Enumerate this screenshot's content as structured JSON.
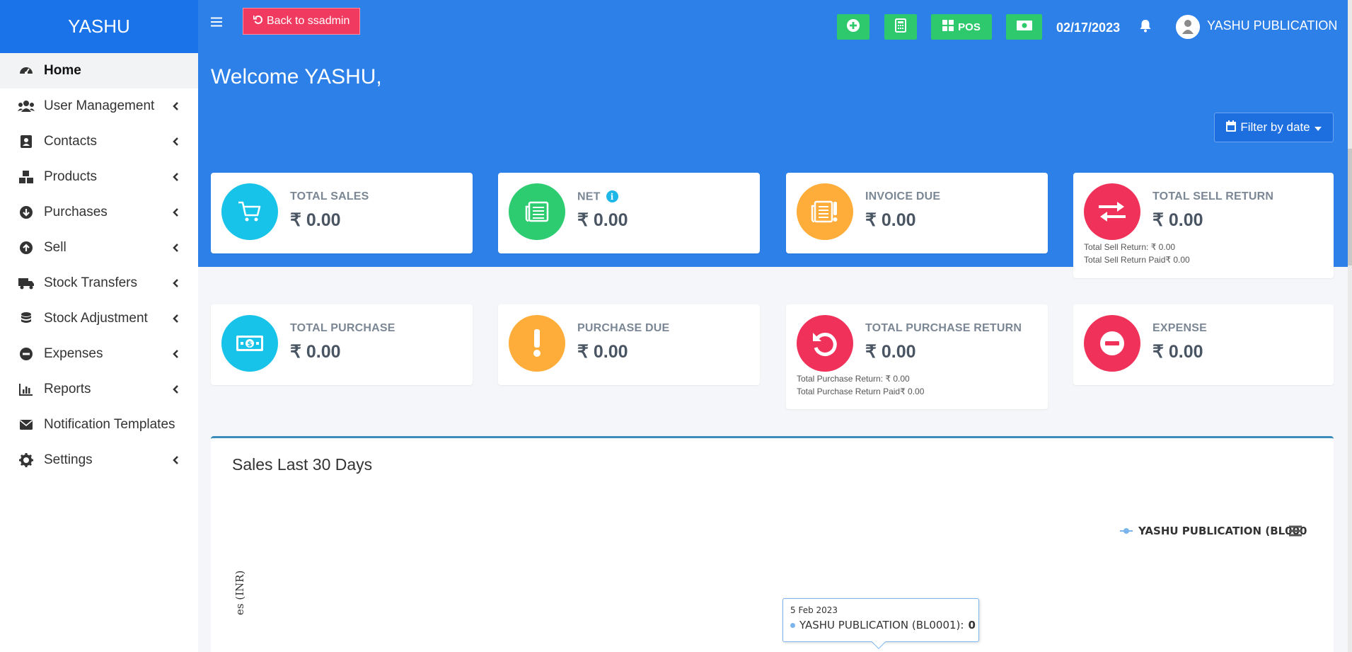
{
  "sidebar": {
    "brand": "YASHU",
    "items": [
      {
        "label": "Home",
        "icon": "tachometer-icon",
        "active": true
      },
      {
        "label": "User Management",
        "icon": "users-icon"
      },
      {
        "label": "Contacts",
        "icon": "address-book-icon"
      },
      {
        "label": "Products",
        "icon": "cubes-icon"
      },
      {
        "label": "Purchases",
        "icon": "arrow-circle-down-icon"
      },
      {
        "label": "Sell",
        "icon": "arrow-circle-up-icon"
      },
      {
        "label": "Stock Transfers",
        "icon": "truck-icon"
      },
      {
        "label": "Stock Adjustment",
        "icon": "database-icon"
      },
      {
        "label": "Expenses",
        "icon": "minus-circle-icon"
      },
      {
        "label": "Reports",
        "icon": "bar-chart-icon"
      },
      {
        "label": "Notification Templates",
        "icon": "envelope-icon"
      },
      {
        "label": "Settings",
        "icon": "gear-icon"
      }
    ]
  },
  "topbar": {
    "back_label": "Back to ssadmin",
    "pos_label": "POS",
    "date": "02/17/2023",
    "user_name": "YASHU PUBLICATION"
  },
  "header": {
    "welcome": "Welcome YASHU,",
    "filter_label": "Filter by date"
  },
  "cards": {
    "total_sales": {
      "label": "TOTAL SALES",
      "value": "₹ 0.00",
      "color": "#17c3e8"
    },
    "net": {
      "label": "NET",
      "value": "₹ 0.00",
      "color": "#2ecc71"
    },
    "invoice_due": {
      "label": "INVOICE DUE",
      "value": "₹ 0.00",
      "color": "#ffad3a"
    },
    "total_sell_return": {
      "label": "TOTAL SELL RETURN",
      "value": "₹ 0.00",
      "color": "#f0325a",
      "note1": "Total Sell Return: ₹ 0.00",
      "note2": "Total Sell Return Paid₹ 0.00"
    },
    "total_purchase": {
      "label": "TOTAL PURCHASE",
      "value": "₹ 0.00",
      "color": "#17c3e8"
    },
    "purchase_due": {
      "label": "PURCHASE DUE",
      "value": "₹ 0.00",
      "color": "#ffad3a"
    },
    "total_purchase_return": {
      "label": "TOTAL PURCHASE RETURN",
      "value": "₹ 0.00",
      "color": "#f0325a",
      "note1": "Total Purchase Return: ₹ 0.00",
      "note2": "Total Purchase Return Paid₹ 0.00"
    },
    "expense": {
      "label": "EXPENSE",
      "value": "₹ 0.00",
      "color": "#f0325a"
    }
  },
  "chart": {
    "title": "Sales Last 30 Days",
    "legend": "YASHU PUBLICATION (BL000",
    "ylabel": "es (INR)",
    "tooltip_date": "5 Feb 2023",
    "tooltip_series": "YASHU PUBLICATION (BL0001):",
    "tooltip_value": "0"
  },
  "colors": {
    "accent": "#2d80e8",
    "brand": "#1a73e8",
    "green": "#2dc96c",
    "danger": "#f03a5f",
    "series": "#7cb5ec"
  }
}
